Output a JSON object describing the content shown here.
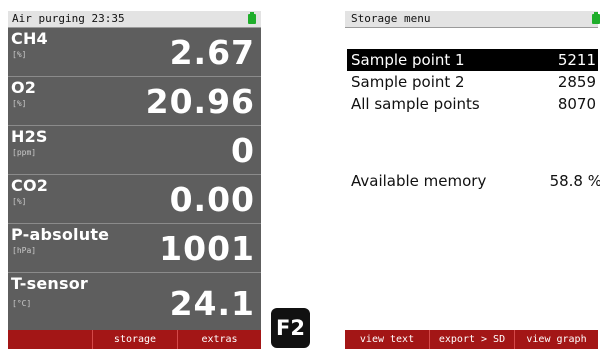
{
  "colors": {
    "display_bg": "#5e5e5e",
    "softkey_bar": "#a31616",
    "battery_indicator": "#1fae2b",
    "selected_row": "#000000"
  },
  "left_screen": {
    "status": {
      "title": "Air purging  23:35",
      "battery_icon": "battery-icon"
    },
    "measurements": [
      {
        "name": "CH4",
        "unit": "[%]",
        "value": "2.67"
      },
      {
        "name": "O2",
        "unit": "[%]",
        "value": "20.96"
      },
      {
        "name": "H2S",
        "unit": "[ppm]",
        "value": "0"
      },
      {
        "name": "CO2",
        "unit": "[%]",
        "value": "0.00"
      },
      {
        "name": "P-absolute",
        "unit": "[hPa]",
        "value": "1001"
      },
      {
        "name": "T-sensor",
        "unit": "[°C]",
        "value": "24.1"
      }
    ],
    "softkeys": [
      "",
      "storage",
      "extras"
    ]
  },
  "key": {
    "label": "F2"
  },
  "right_screen": {
    "status": {
      "title": "Storage menu",
      "battery_icon": "battery-icon"
    },
    "items": [
      {
        "label": "Sample point 1",
        "count": "5211",
        "selected": true
      },
      {
        "label": "Sample point 2",
        "count": "2859",
        "selected": false
      },
      {
        "label": "All sample points",
        "count": "8070",
        "selected": false
      }
    ],
    "memory": {
      "label": "Available memory",
      "value": "58.8 %"
    },
    "softkeys": [
      "view text",
      "export > SD",
      "view graph"
    ]
  }
}
